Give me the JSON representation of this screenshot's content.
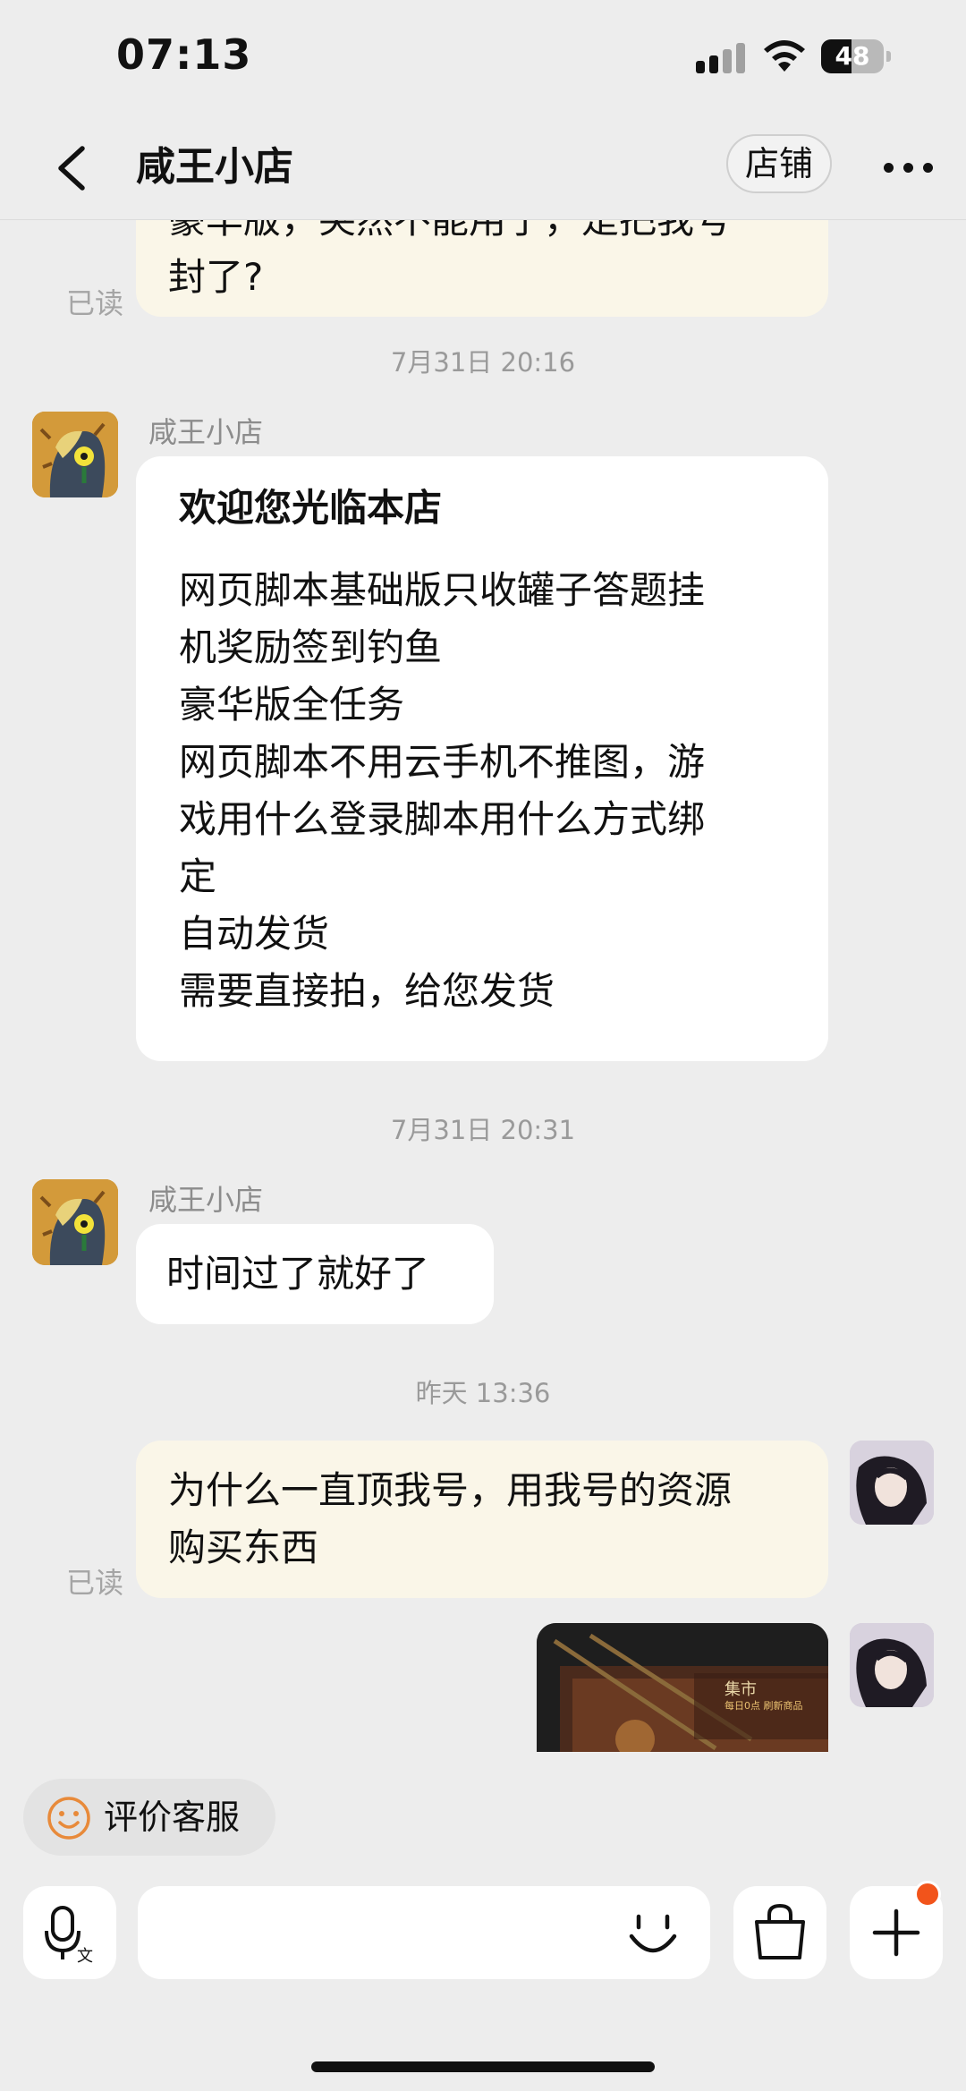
{
  "status_bar": {
    "time": "07:13",
    "battery": "48",
    "battery_level": 0.48
  },
  "nav": {
    "title": "咸王小店",
    "shop_button": "店铺"
  },
  "chat": {
    "messages": [
      {
        "type": "outgoing",
        "lines": [
          "豪华版，突然不能用了，是把我号",
          "封了?"
        ],
        "read": "已读"
      },
      {
        "type": "timestamp",
        "text": "7月31日 20:16"
      },
      {
        "type": "incoming",
        "sender": "咸王小店",
        "title": "欢迎您光临本店",
        "lines": [
          "网页脚本基础版只收罐子答题挂",
          "机奖励签到钓鱼",
          "豪华版全任务",
          "网页脚本不用云手机不推图，游",
          "戏用什么登录脚本用什么方式绑",
          "定",
          "自动发货",
          "需要直接拍，给您发货"
        ]
      },
      {
        "type": "timestamp",
        "text": "7月31日 20:31"
      },
      {
        "type": "incoming",
        "sender": "咸王小店",
        "lines": [
          "时间过了就好了"
        ]
      },
      {
        "type": "timestamp",
        "text": "昨天 13:36"
      },
      {
        "type": "outgoing",
        "lines": [
          "为什么一直顶我号，用我号的资源",
          "购买东西"
        ],
        "read": "已读"
      },
      {
        "type": "outgoing-image",
        "caption_title": "集市",
        "caption_sub": "每日0点 刷新商品"
      }
    ]
  },
  "bottom": {
    "rate_label": "评价客服",
    "input_placeholder": "",
    "input_value": ""
  },
  "colors": {
    "outgoing_bubble": "#faf6e8",
    "incoming_bubble": "#ffffff",
    "background": "#ededed",
    "badge": "#f2541b",
    "rate_icon": "#e88a3a"
  },
  "icons": [
    "back-icon",
    "more-icon",
    "smile-icon",
    "microphone-icon",
    "emoji-icon",
    "shopping-bag-icon",
    "plus-icon"
  ]
}
